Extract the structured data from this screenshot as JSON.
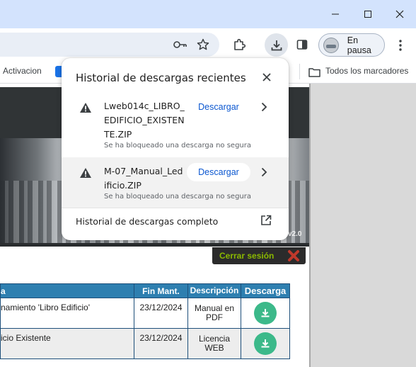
{
  "window": {
    "minimize_label": "minimize",
    "maximize_label": "maximize",
    "close_label": "close"
  },
  "toolbar": {
    "profile_label": "En pausa"
  },
  "bookmarks": {
    "item1": "Activacion",
    "all_label": "Todos los marcadores"
  },
  "downloads_popup": {
    "title": "Historial de descargas recientes",
    "items": [
      {
        "filename": "Lweb014c_LIBRO_\nEDIFICIO_EXISTEN\nTE.ZIP",
        "status": "Se ha bloqueado una descarga no segura",
        "action": "Descargar"
      },
      {
        "filename": "M-07_Manual_Led\nificio.ZIP",
        "status": "Se ha bloqueado una descarga no segura",
        "action": "Descargar"
      }
    ],
    "full_history_label": "Historial de descargas completo"
  },
  "page": {
    "version_badge": "v2.0",
    "logout_label": "Cerrar sesión",
    "table": {
      "headers": [
        "a",
        "Fin Mant.",
        "Descripción",
        "Descarga"
      ],
      "rows": [
        {
          "title": "namiento 'Libro Edificio'",
          "date": "23/12/2024",
          "desc": "Manual en PDF"
        },
        {
          "title": "icio Existente",
          "date": "23/12/2024",
          "desc": "Licencia WEB"
        }
      ]
    }
  },
  "colors": {
    "titlebar": "#d3e3fd",
    "link_blue": "#0b57d0",
    "table_header": "#2e7fb0",
    "download_green": "#3cb98a",
    "logout_green": "#8ab800"
  }
}
